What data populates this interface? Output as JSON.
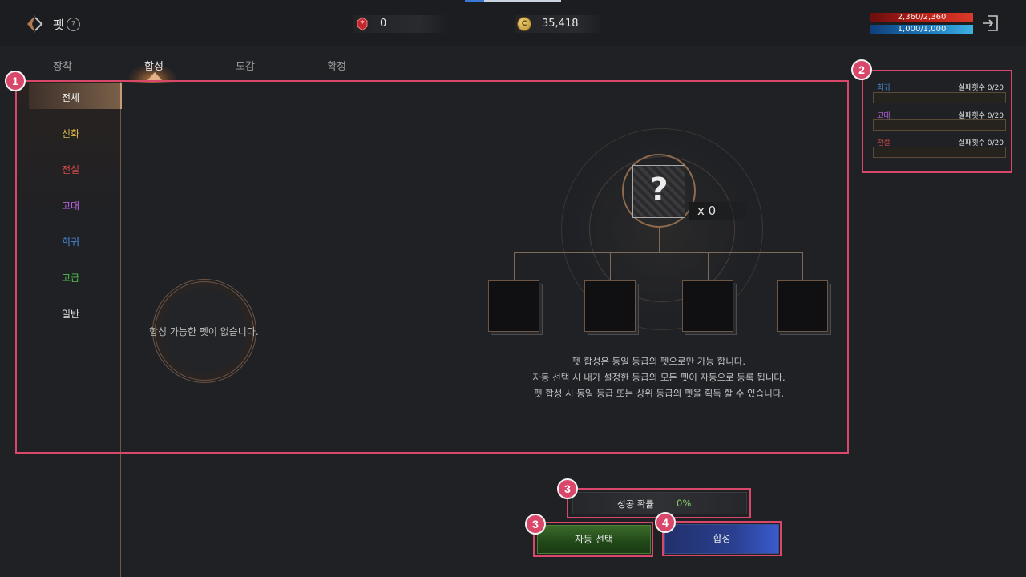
{
  "header": {
    "title": "펫",
    "help": "?",
    "gem_value": "0",
    "coin_symbol": "C",
    "coin_value": "35,418",
    "hp": "2,360/2,360",
    "mp": "1,000/1,000"
  },
  "tabs": [
    {
      "label": "장착"
    },
    {
      "label": "합성",
      "active": true
    },
    {
      "label": "도감"
    },
    {
      "label": "확정"
    }
  ],
  "sidebar": {
    "items": [
      {
        "label": "전체",
        "color": "#f0f0f0",
        "active": true
      },
      {
        "label": "신화",
        "color": "#d8b74a"
      },
      {
        "label": "전설",
        "color": "#d84a4a"
      },
      {
        "label": "고대",
        "color": "#b865e0"
      },
      {
        "label": "희귀",
        "color": "#4a8ee0"
      },
      {
        "label": "고급",
        "color": "#4fc24f"
      },
      {
        "label": "일반",
        "color": "#e0e0e0"
      }
    ]
  },
  "empty_list": {
    "text": "합성 가능한 펫이 없습니다."
  },
  "result": {
    "symbol": "?",
    "count": "x 0"
  },
  "description": [
    "펫 합성은 동일 등급의 펫으로만 가능 합니다.",
    "자동 선택 시 내가 설정한 등급의 모든 펫이 자동으로 등록 됩니다.",
    "펫 합성 시 동일 등급 또는 상위 등급의 펫을 획득 할 수 있습니다."
  ],
  "fail_panel": [
    {
      "grade": "희귀",
      "grade_color": "#4a8ee0",
      "count": "실패횟수 0/20"
    },
    {
      "grade": "고대",
      "grade_color": "#b865e0",
      "count": "실패횟수 0/20"
    },
    {
      "grade": "전설",
      "grade_color": "#d84a4a",
      "count": "실패횟수 0/20"
    }
  ],
  "bottom": {
    "prob_label": "성공 확률",
    "prob_value": "0%",
    "auto_select": "자동 선택",
    "synthesize": "합성"
  },
  "annotations": [
    "1",
    "2",
    "3",
    "3",
    "4"
  ],
  "colors": {
    "accent": "#d9476a",
    "background": "#1f2125"
  }
}
